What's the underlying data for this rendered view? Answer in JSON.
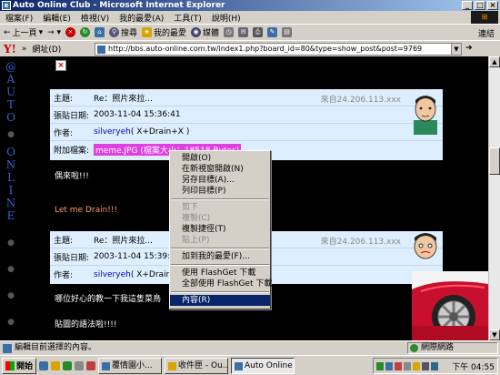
{
  "window": {
    "title": "Auto Online Club - Microsoft Internet Explorer"
  },
  "menu": [
    "檔案(F)",
    "編輯(E)",
    "檢視(V)",
    "我的最愛(A)",
    "工具(T)",
    "說明(H)"
  ],
  "toolbar": {
    "back": "上一頁",
    "search": "搜尋",
    "favorites": "我的最愛",
    "media": "媒體",
    "links": "連結"
  },
  "address": {
    "prefix": "»",
    "label": "網址(D)",
    "url": "http://bbs.auto-online.com.tw/index1.php?board_id=80&type=show_post&post=9769"
  },
  "sidebar": {
    "letters": [
      "@",
      "A",
      "U",
      "T",
      "O",
      "O",
      "N",
      "L",
      "I",
      "N",
      "E"
    ],
    "bottom": "C"
  },
  "posts": [
    {
      "subject_label": "主題:",
      "subject": "Re：照片來拉...",
      "from": "來自24.206.113.xxx",
      "date_label": "張貼日期:",
      "date": "2003-11-04 15:36:41",
      "author_label": "作者:",
      "author": "silveryeh",
      "author_suffix": " ( X+Drain+X )",
      "attach_label": "附加檔案:",
      "attach": "meme.JPG (檔案大小：18518 Bytes)"
    },
    {
      "subject_label": "主題:",
      "subject": "Re：照片來拉...",
      "from": "來自24.206.113.xxx",
      "date_label": "張貼日期:",
      "date": "2003-11-04 15:39:42",
      "author_label": "作者:",
      "author": "silveryeh",
      "author_suffix": " ( X+Drain+X )"
    }
  ],
  "messages": {
    "m1": "偶來啦!!!",
    "m2": "Let me Drain!!!",
    "m3": "哪位好心的教一下我這隻菜鳥",
    "m4": "貼圖的語法啦!!!!"
  },
  "context_menu": [
    "開啟(O)",
    "在新視窗開啟(N)",
    "另存目標(A)...",
    "列印目標(P)",
    "剪下",
    "複製(C)",
    "複製捷徑(T)",
    "貼上(P)",
    "加到我的最愛(F)...",
    "使用 FlashGet 下載",
    "全部使用 FlashGet 下載",
    "內容(R)"
  ],
  "status": {
    "text": "編輯目前選擇的內容。",
    "zone": "網際網路"
  },
  "taskbar": {
    "start": "開始",
    "tasks": [
      "覆情園小...",
      "收件匣 - Ou...",
      "Auto Online ..."
    ],
    "clock": "下午 04:55"
  },
  "colors": {
    "accent": "#0a246a",
    "post_bg": "#ddeeff",
    "attachment": "#e040e0"
  }
}
